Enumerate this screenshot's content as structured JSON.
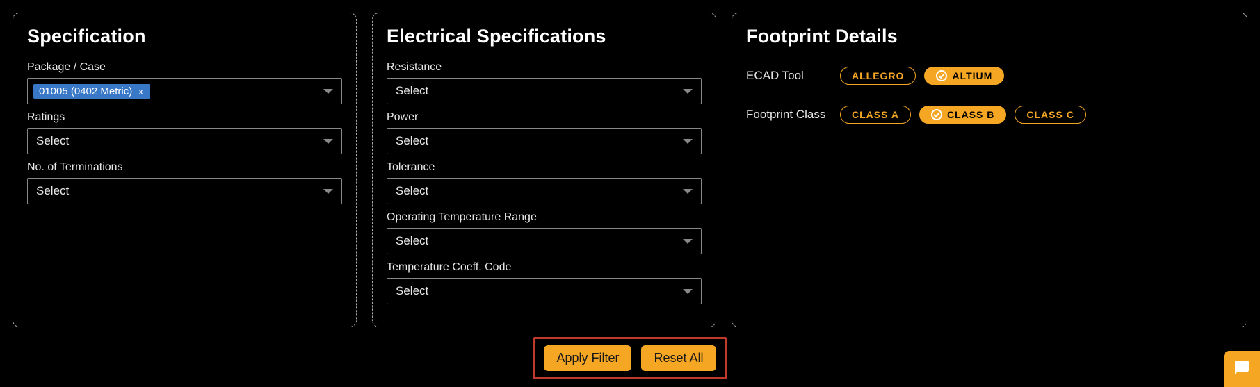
{
  "spec": {
    "title": "Specification",
    "package_case": {
      "label": "Package / Case",
      "selected_chip": "01005 (0402 Metric)",
      "chip_close": "x"
    },
    "ratings": {
      "label": "Ratings",
      "value": "Select"
    },
    "terminations": {
      "label": "No. of Terminations",
      "value": "Select"
    }
  },
  "elec": {
    "title": "Electrical Specifications",
    "resistance": {
      "label": "Resistance",
      "value": "Select"
    },
    "power": {
      "label": "Power",
      "value": "Select"
    },
    "tolerance": {
      "label": "Tolerance",
      "value": "Select"
    },
    "op_temp": {
      "label": "Operating Temperature Range",
      "value": "Select"
    },
    "temp_coeff": {
      "label": "Temperature Coeff. Code",
      "value": "Select"
    }
  },
  "foot": {
    "title": "Footprint Details",
    "ecad_tool": {
      "label": "ECAD Tool",
      "options": [
        "ALLEGRO",
        "ALTIUM"
      ],
      "selected": "ALTIUM"
    },
    "footprint_class": {
      "label": "Footprint Class",
      "options": [
        "CLASS A",
        "CLASS B",
        "CLASS C"
      ],
      "selected": "CLASS B"
    }
  },
  "actions": {
    "apply": "Apply Filter",
    "reset": "Reset All"
  }
}
